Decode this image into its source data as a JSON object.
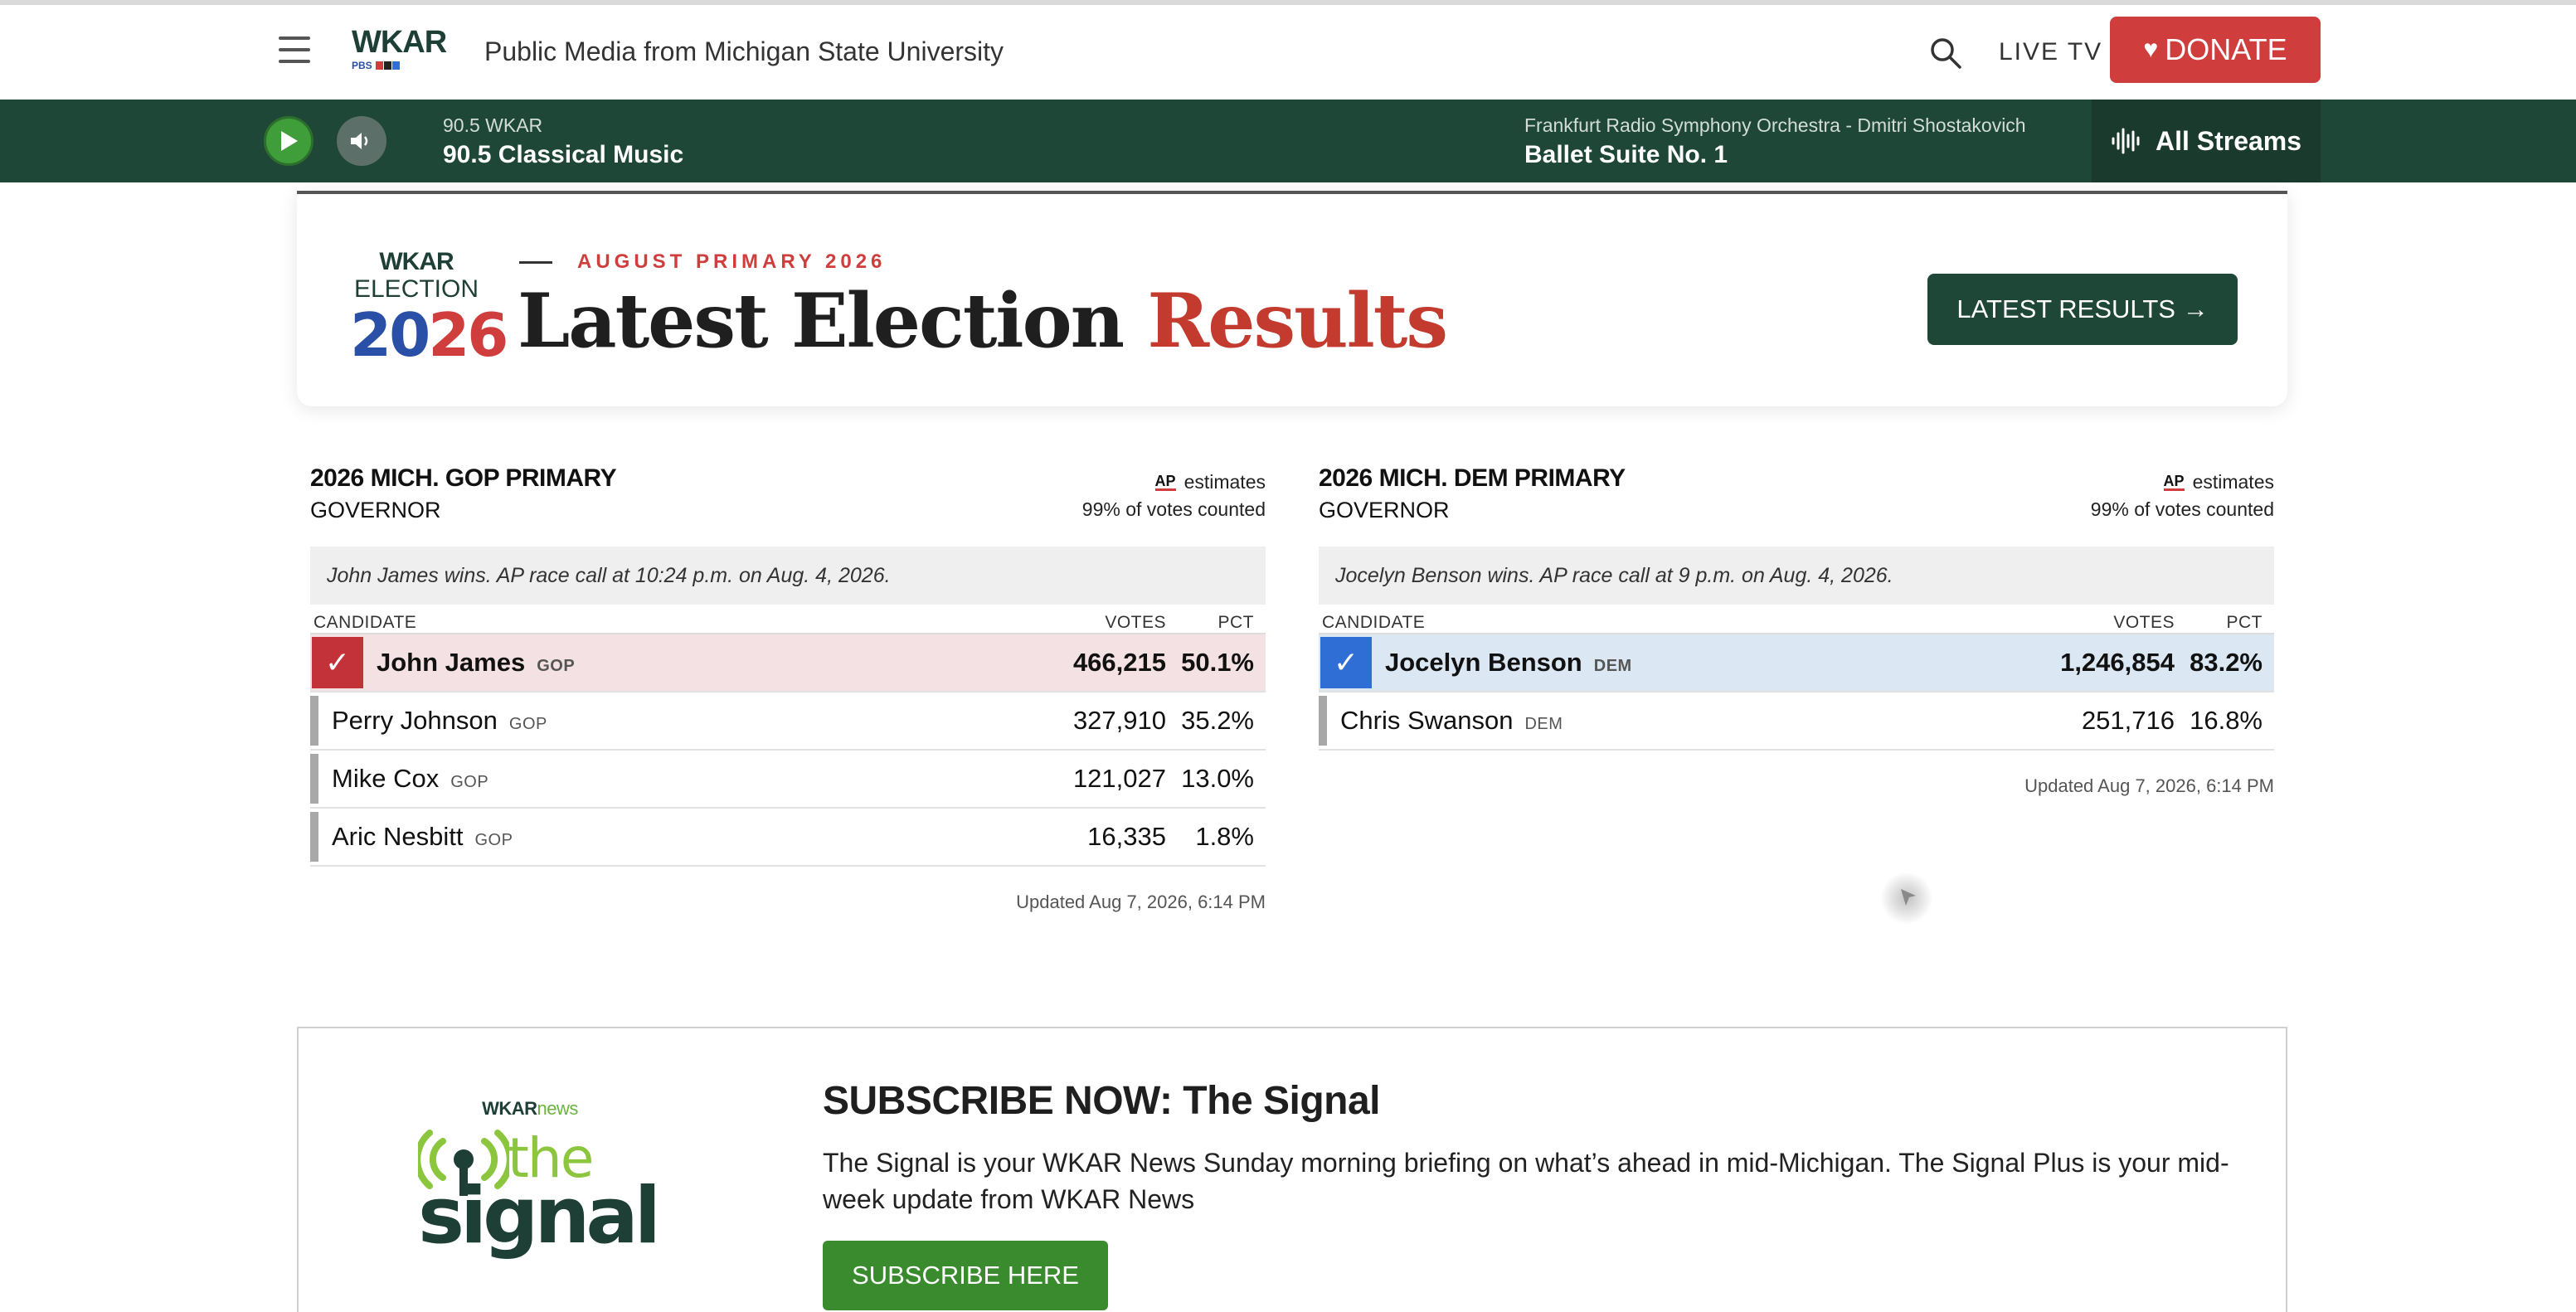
{
  "header": {
    "tagline": "Public Media from Michigan State University",
    "logo_text": "WKAR",
    "logo_sub": "PBS",
    "live_tv": "LIVE TV",
    "donate": "DONATE"
  },
  "player": {
    "station_small": "90.5 WKAR",
    "station_big": "90.5 Classical Music",
    "now_small": "Frankfurt Radio Symphony Orchestra - Dmitri Shostakovich",
    "now_big": "Ballet Suite No. 1",
    "all_streams": "All Streams"
  },
  "banner": {
    "logo_wkar": "WKAR",
    "logo_election": "ELECTION",
    "logo_year_a": "20",
    "logo_year_b": "26",
    "eyebrow": "AUGUST PRIMARY 2026",
    "headline_main": "Latest Election ",
    "headline_accent": "Results",
    "button": "LATEST RESULTS →"
  },
  "races": {
    "gop": {
      "title": "2026 MICH. GOP PRIMARY",
      "subtitle": "GOVERNOR",
      "ap_logo": "AP",
      "ap_estimates": "estimates",
      "ap_counted": "99% of votes counted",
      "call": "John James wins. AP race call at 10:24 p.m. on Aug. 4, 2026.",
      "col_candidate": "CANDIDATE",
      "col_votes": "VOTES",
      "col_pct": "PCT",
      "rows": [
        {
          "name": "John James",
          "party": "GOP",
          "votes": "466,215",
          "pct": "50.1%"
        },
        {
          "name": "Perry Johnson",
          "party": "GOP",
          "votes": "327,910",
          "pct": "35.2%"
        },
        {
          "name": "Mike Cox",
          "party": "GOP",
          "votes": "121,027",
          "pct": "13.0%"
        },
        {
          "name": "Aric Nesbitt",
          "party": "GOP",
          "votes": "16,335",
          "pct": "1.8%"
        }
      ],
      "updated": "Updated Aug 7, 2026, 6:14 PM"
    },
    "dem": {
      "title": "2026 MICH. DEM PRIMARY",
      "subtitle": "GOVERNOR",
      "ap_logo": "AP",
      "ap_estimates": "estimates",
      "ap_counted": "99% of votes counted",
      "call": "Jocelyn Benson wins. AP race call at 9 p.m. on Aug. 4, 2026.",
      "col_candidate": "CANDIDATE",
      "col_votes": "VOTES",
      "col_pct": "PCT",
      "rows": [
        {
          "name": "Jocelyn Benson",
          "party": "DEM",
          "votes": "1,246,854",
          "pct": "83.2%"
        },
        {
          "name": "Chris Swanson",
          "party": "DEM",
          "votes": "251,716",
          "pct": "16.8%"
        }
      ],
      "updated": "Updated Aug 7, 2026, 6:14 PM"
    }
  },
  "subscribe": {
    "logo_wkar": "WKAR",
    "logo_news": "news",
    "logo_the": "the",
    "logo_signal": "signal",
    "title": "SUBSCRIBE NOW: The Signal",
    "description": "The Signal is your WKAR News Sunday morning briefing on what’s ahead in mid-Michigan. The Signal Plus is your mid-week update from WKAR News",
    "button": "SUBSCRIBE HERE"
  },
  "colors": {
    "brand_green": "#1f4738",
    "donate_red": "#cf3d3d",
    "gop_red": "#c23238",
    "dem_blue": "#2f6ed4",
    "subscribe_green": "#3a8a2e"
  },
  "icons": {
    "menu": "hamburger-icon",
    "search": "search-icon",
    "play": "play-icon",
    "volume": "volume-icon",
    "streams": "audio-wave-icon",
    "donate": "heart-icon",
    "winner": "check-icon"
  }
}
